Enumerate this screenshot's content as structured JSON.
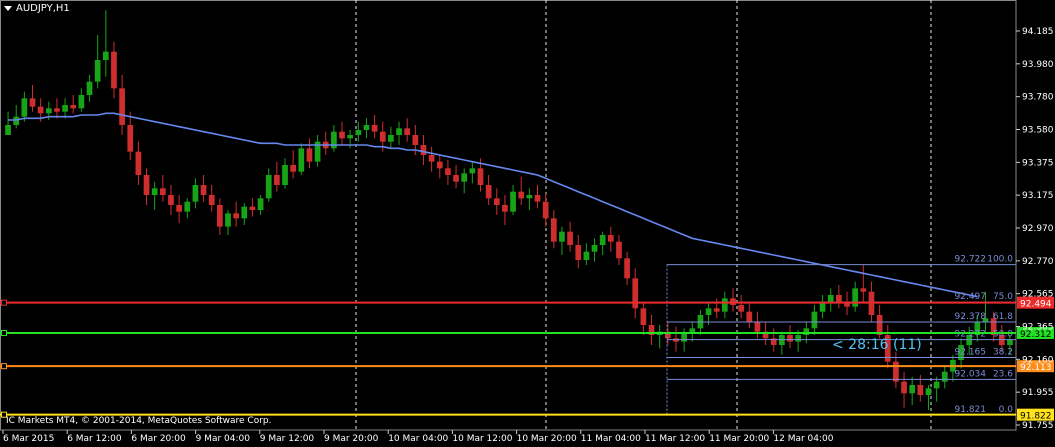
{
  "symbol_label": "AUDJPY,H1",
  "copyright": "IC Markets MT4, © 2001-2014, MetaQuotes Software Corp.",
  "countdown": "< 28:16 (11)",
  "colors": {
    "background": "#000000",
    "bull": "#18a418",
    "bear": "#cf2e2e",
    "ma": "#6688ee",
    "fib": "#7a8cd6",
    "grid": "#e8e8e8",
    "resistance": "#ee2a2a",
    "pivot": "#22e022",
    "support1": "#ff8c1a",
    "support2": "#ffe21a"
  },
  "price_axis_ticks": [
    "94.185",
    "93.980",
    "93.780",
    "93.580",
    "93.375",
    "93.175",
    "92.970",
    "92.770",
    "92.565",
    "92.365",
    "92.160",
    "91.955",
    "91.755"
  ],
  "time_axis_labels": [
    "6 Mar 2015",
    "6 Mar 12:00",
    "6 Mar 20:00",
    "9 Mar 04:00",
    "9 Mar 12:00",
    "9 Mar 20:00",
    "10 Mar 04:00",
    "10 Mar 12:00",
    "10 Mar 20:00",
    "11 Mar 04:00",
    "11 Mar 12:00",
    "11 Mar 20:00",
    "12 Mar 04:00"
  ],
  "horizontal_lines": [
    {
      "name": "resistance",
      "price": 92.494,
      "label": "92.494",
      "color": "#ee2a2a"
    },
    {
      "name": "pivot",
      "price": 92.312,
      "label": "92.312",
      "color": "#22e022"
    },
    {
      "name": "support-1",
      "price": 92.113,
      "label": "92.113",
      "color": "#ff8c1a"
    },
    {
      "name": "support-2",
      "price": 91.822,
      "label": "91.822",
      "color": "#ffe21a"
    }
  ],
  "fibonacci": [
    {
      "price_text": "92.722",
      "level": "100.0",
      "price": 92.722
    },
    {
      "price_text": "92.497",
      "level": "75.0",
      "price": 92.497
    },
    {
      "price_text": "92.378",
      "level": "61.8",
      "price": 92.378
    },
    {
      "price_text": "92.272",
      "level": "50.0",
      "price": 92.272
    },
    {
      "price_text": "92.165",
      "level": "38.2",
      "price": 92.165
    },
    {
      "price_text": "92.034",
      "level": "23.6",
      "price": 92.034
    },
    {
      "price_text": "91.821",
      "level": "0.0",
      "price": 91.821
    }
  ],
  "chart_data": {
    "type": "candlestick",
    "symbol": "AUDJPY",
    "timeframe": "H1",
    "ylim": [
      91.73,
      94.31
    ],
    "bars_count": 154,
    "last_price": 92.312,
    "ohlc_bars": [
      [
        93.5,
        93.64,
        93.53,
        93.56
      ],
      [
        93.56,
        93.68,
        93.54,
        93.61
      ],
      [
        93.61,
        93.76,
        93.58,
        93.72
      ],
      [
        93.72,
        93.8,
        93.64,
        93.67
      ],
      [
        93.67,
        93.72,
        93.58,
        93.63
      ],
      [
        93.63,
        93.7,
        93.59,
        93.66
      ],
      [
        93.66,
        93.72,
        93.6,
        93.64
      ],
      [
        93.64,
        93.72,
        93.6,
        93.68
      ],
      [
        93.68,
        93.74,
        93.63,
        93.66
      ],
      [
        93.66,
        93.78,
        93.64,
        93.74
      ],
      [
        93.74,
        93.86,
        93.7,
        93.82
      ],
      [
        93.82,
        94.1,
        93.78,
        93.95
      ],
      [
        93.95,
        94.25,
        93.85,
        94.0
      ],
      [
        94.0,
        94.06,
        93.72,
        93.78
      ],
      [
        93.78,
        93.86,
        93.5,
        93.56
      ],
      [
        93.56,
        93.64,
        93.35,
        93.4
      ],
      [
        93.4,
        93.46,
        93.2,
        93.26
      ],
      [
        93.26,
        93.3,
        93.08,
        93.14
      ],
      [
        93.14,
        93.22,
        93.05,
        93.18
      ],
      [
        93.18,
        93.26,
        93.1,
        93.14
      ],
      [
        93.14,
        93.2,
        93.02,
        93.08
      ],
      [
        93.08,
        93.14,
        92.97,
        93.04
      ],
      [
        93.04,
        93.12,
        93.0,
        93.1
      ],
      [
        93.1,
        93.24,
        93.06,
        93.2
      ],
      [
        93.2,
        93.26,
        93.1,
        93.14
      ],
      [
        93.14,
        93.2,
        93.04,
        93.08
      ],
      [
        93.08,
        93.12,
        92.9,
        92.95
      ],
      [
        92.95,
        93.05,
        92.9,
        93.03
      ],
      [
        93.03,
        93.1,
        92.95,
        93.0
      ],
      [
        93.0,
        93.09,
        92.96,
        93.07
      ],
      [
        93.07,
        93.12,
        93.01,
        93.05
      ],
      [
        93.05,
        93.14,
        93.02,
        93.12
      ],
      [
        93.12,
        93.3,
        93.1,
        93.26
      ],
      [
        93.26,
        93.34,
        93.16,
        93.2
      ],
      [
        93.2,
        93.36,
        93.18,
        93.32
      ],
      [
        93.32,
        93.41,
        93.24,
        93.28
      ],
      [
        93.28,
        93.45,
        93.26,
        93.42
      ],
      [
        93.42,
        93.48,
        93.3,
        93.34
      ],
      [
        93.34,
        93.5,
        93.31,
        93.46
      ],
      [
        93.46,
        93.52,
        93.38,
        93.42
      ],
      [
        93.42,
        93.56,
        93.4,
        93.52
      ],
      [
        93.52,
        93.58,
        93.44,
        93.48
      ],
      [
        93.48,
        93.53,
        93.42,
        93.5
      ],
      [
        93.5,
        93.58,
        93.46,
        93.53
      ],
      [
        93.53,
        93.6,
        93.48,
        93.56
      ],
      [
        93.56,
        93.62,
        93.48,
        93.52
      ],
      [
        93.52,
        93.58,
        93.4,
        93.46
      ],
      [
        93.46,
        93.55,
        93.42,
        93.5
      ],
      [
        93.5,
        93.58,
        93.44,
        93.54
      ],
      [
        93.54,
        93.6,
        93.46,
        93.5
      ],
      [
        93.5,
        93.56,
        93.38,
        93.44
      ],
      [
        93.44,
        93.5,
        93.32,
        93.38
      ],
      [
        93.38,
        93.43,
        93.28,
        93.34
      ],
      [
        93.34,
        93.38,
        93.24,
        93.3
      ],
      [
        93.3,
        93.35,
        93.2,
        93.26
      ],
      [
        93.26,
        93.32,
        93.18,
        93.22
      ],
      [
        93.22,
        93.3,
        93.15,
        93.27
      ],
      [
        93.27,
        93.34,
        93.21,
        93.3
      ],
      [
        93.3,
        93.36,
        93.16,
        93.2
      ],
      [
        93.2,
        93.26,
        93.08,
        93.12
      ],
      [
        93.12,
        93.18,
        93.02,
        93.08
      ],
      [
        93.08,
        93.14,
        92.96,
        93.04
      ],
      [
        93.04,
        93.2,
        93.02,
        93.16
      ],
      [
        93.16,
        93.25,
        93.08,
        93.12
      ],
      [
        93.12,
        93.18,
        93.05,
        93.14
      ],
      [
        93.14,
        93.2,
        93.06,
        93.1
      ],
      [
        93.1,
        93.15,
        92.95,
        93.0
      ],
      [
        93.0,
        93.05,
        92.82,
        92.86
      ],
      [
        92.86,
        92.95,
        92.78,
        92.92
      ],
      [
        92.92,
        92.98,
        92.8,
        92.84
      ],
      [
        92.84,
        92.9,
        92.7,
        92.75
      ],
      [
        92.75,
        92.85,
        92.72,
        92.8
      ],
      [
        92.8,
        92.88,
        92.74,
        92.84
      ],
      [
        92.84,
        92.92,
        92.78,
        92.9
      ],
      [
        92.9,
        92.95,
        92.8,
        92.86
      ],
      [
        92.86,
        92.9,
        92.72,
        92.76
      ],
      [
        92.76,
        92.8,
        92.6,
        92.64
      ],
      [
        92.64,
        92.7,
        92.4,
        92.46
      ],
      [
        92.46,
        92.5,
        92.3,
        92.36
      ],
      [
        92.36,
        92.42,
        92.24,
        92.3
      ],
      [
        92.3,
        92.36,
        92.22,
        92.32
      ],
      [
        92.32,
        92.38,
        92.24,
        92.28
      ],
      [
        92.28,
        92.35,
        92.2,
        92.26
      ],
      [
        92.26,
        92.34,
        92.2,
        92.31
      ],
      [
        92.31,
        92.38,
        92.26,
        92.34
      ],
      [
        92.34,
        92.45,
        92.3,
        92.42
      ],
      [
        92.42,
        92.5,
        92.36,
        92.46
      ],
      [
        92.46,
        92.52,
        92.4,
        92.44
      ],
      [
        92.44,
        92.56,
        92.4,
        92.52
      ],
      [
        92.52,
        92.58,
        92.44,
        92.48
      ],
      [
        92.48,
        92.54,
        92.4,
        92.44
      ],
      [
        92.44,
        92.5,
        92.34,
        92.38
      ],
      [
        92.38,
        92.44,
        92.28,
        92.32
      ],
      [
        92.32,
        92.38,
        92.24,
        92.28
      ],
      [
        92.28,
        92.34,
        92.2,
        92.24
      ],
      [
        92.24,
        92.32,
        92.18,
        92.3
      ],
      [
        92.3,
        92.36,
        92.22,
        92.26
      ],
      [
        92.26,
        92.33,
        92.2,
        92.3
      ],
      [
        92.3,
        92.38,
        92.25,
        92.34
      ],
      [
        92.34,
        92.48,
        92.3,
        92.44
      ],
      [
        92.44,
        92.54,
        92.4,
        92.5
      ],
      [
        92.5,
        92.58,
        92.44,
        92.54
      ],
      [
        92.54,
        92.6,
        92.46,
        92.5
      ],
      [
        92.5,
        92.56,
        92.42,
        92.47
      ],
      [
        92.47,
        92.62,
        92.44,
        92.58
      ],
      [
        92.58,
        92.72,
        92.5,
        92.56
      ],
      [
        92.56,
        92.62,
        92.38,
        92.42
      ],
      [
        92.42,
        92.48,
        92.28,
        92.3
      ],
      [
        92.3,
        92.36,
        92.1,
        92.14
      ],
      [
        92.14,
        92.2,
        91.98,
        92.02
      ],
      [
        92.02,
        92.08,
        91.86,
        91.95
      ],
      [
        91.95,
        92.05,
        91.88,
        92.0
      ],
      [
        92.0,
        92.06,
        91.9,
        91.94
      ],
      [
        91.94,
        92.0,
        91.85,
        91.98
      ],
      [
        91.98,
        92.05,
        91.9,
        92.02
      ],
      [
        92.02,
        92.12,
        91.98,
        92.08
      ],
      [
        92.08,
        92.18,
        92.02,
        92.15
      ],
      [
        92.15,
        92.28,
        92.1,
        92.24
      ],
      [
        92.24,
        92.35,
        92.18,
        92.3
      ],
      [
        92.3,
        92.42,
        92.26,
        92.38
      ],
      [
        92.38,
        92.56,
        92.32,
        92.4
      ],
      [
        92.4,
        92.44,
        92.26,
        92.3
      ],
      [
        92.3,
        92.36,
        92.2,
        92.24
      ],
      [
        92.24,
        92.3,
        92.18,
        92.27
      ]
    ],
    "moving_average": {
      "first_bar_index": 0,
      "values": [
        93.59,
        93.59,
        93.6,
        93.6,
        93.6,
        93.61,
        93.61,
        93.61,
        93.61,
        93.62,
        93.62,
        93.62,
        93.63,
        93.63,
        93.62,
        93.61,
        93.6,
        93.59,
        93.58,
        93.57,
        93.56,
        93.55,
        93.54,
        93.53,
        93.52,
        93.51,
        93.5,
        93.49,
        93.48,
        93.47,
        93.46,
        93.45,
        93.45,
        93.45,
        93.44,
        93.44,
        93.44,
        93.44,
        93.44,
        93.44,
        93.44,
        93.44,
        93.44,
        93.44,
        93.44,
        93.43,
        93.43,
        93.42,
        93.42,
        93.41,
        93.41,
        93.4,
        93.39,
        93.38,
        93.37,
        93.36,
        93.35,
        93.34,
        93.33,
        93.32,
        93.31,
        93.3,
        93.29,
        93.28,
        93.27,
        93.26,
        93.24,
        93.22,
        93.2,
        93.18,
        93.16,
        93.14,
        93.12,
        93.1,
        93.08,
        93.06,
        93.04,
        93.02,
        93.0,
        92.98,
        92.96,
        92.94,
        92.92,
        92.9,
        92.88,
        92.87,
        92.86,
        92.85,
        92.84,
        92.83,
        92.82,
        92.81,
        92.8,
        92.79,
        92.78,
        92.77,
        92.76,
        92.75,
        92.74,
        92.73,
        92.72,
        92.71,
        92.7,
        92.69,
        92.68,
        92.67,
        92.66,
        92.65,
        92.64,
        92.63,
        92.62,
        92.61,
        92.6,
        92.59,
        92.58,
        92.57,
        92.56,
        92.55,
        92.54,
        92.53
      ]
    }
  }
}
